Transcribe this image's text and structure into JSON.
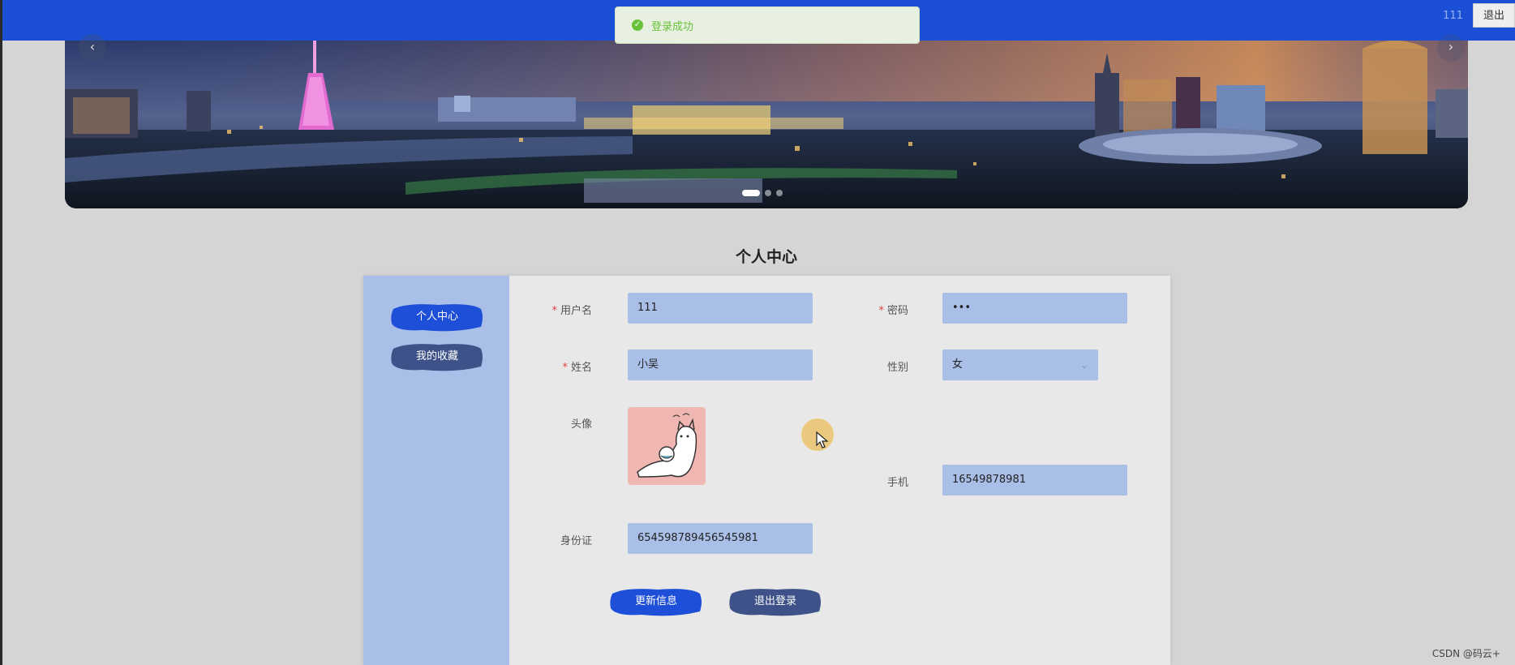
{
  "header": {
    "username": "111",
    "logout_label": "退出"
  },
  "toast": {
    "message": "登录成功",
    "icon": "check-circle-icon",
    "color": "#67c23a"
  },
  "carousel": {
    "prev_icon": "chevron-left-icon",
    "next_icon": "chevron-right-icon",
    "slide_count": 3,
    "active_index": 0
  },
  "page": {
    "title": "个人中心"
  },
  "sidebar": {
    "items": [
      {
        "label": "个人中心",
        "active": true
      },
      {
        "label": "我的收藏",
        "active": false
      }
    ]
  },
  "form": {
    "username": {
      "label": "用户名",
      "value": "111",
      "required": true
    },
    "password": {
      "label": "密码",
      "value": "•••",
      "required": true
    },
    "name": {
      "label": "姓名",
      "value": "小吴",
      "required": true
    },
    "gender": {
      "label": "性别",
      "value": "女"
    },
    "avatar": {
      "label": "头像"
    },
    "phone": {
      "label": "手机",
      "value": "16549878981"
    },
    "idcard": {
      "label": "身份证",
      "value": "654598789456545981"
    }
  },
  "actions": {
    "update_label": "更新信息",
    "logout_label": "退出登录"
  },
  "colors": {
    "header": "#1a4fd6",
    "field_bg": "#aabfe8",
    "brush_active": "#1e4fd8",
    "brush_inactive": "#3e5289"
  },
  "watermark": "CSDN @码云+"
}
